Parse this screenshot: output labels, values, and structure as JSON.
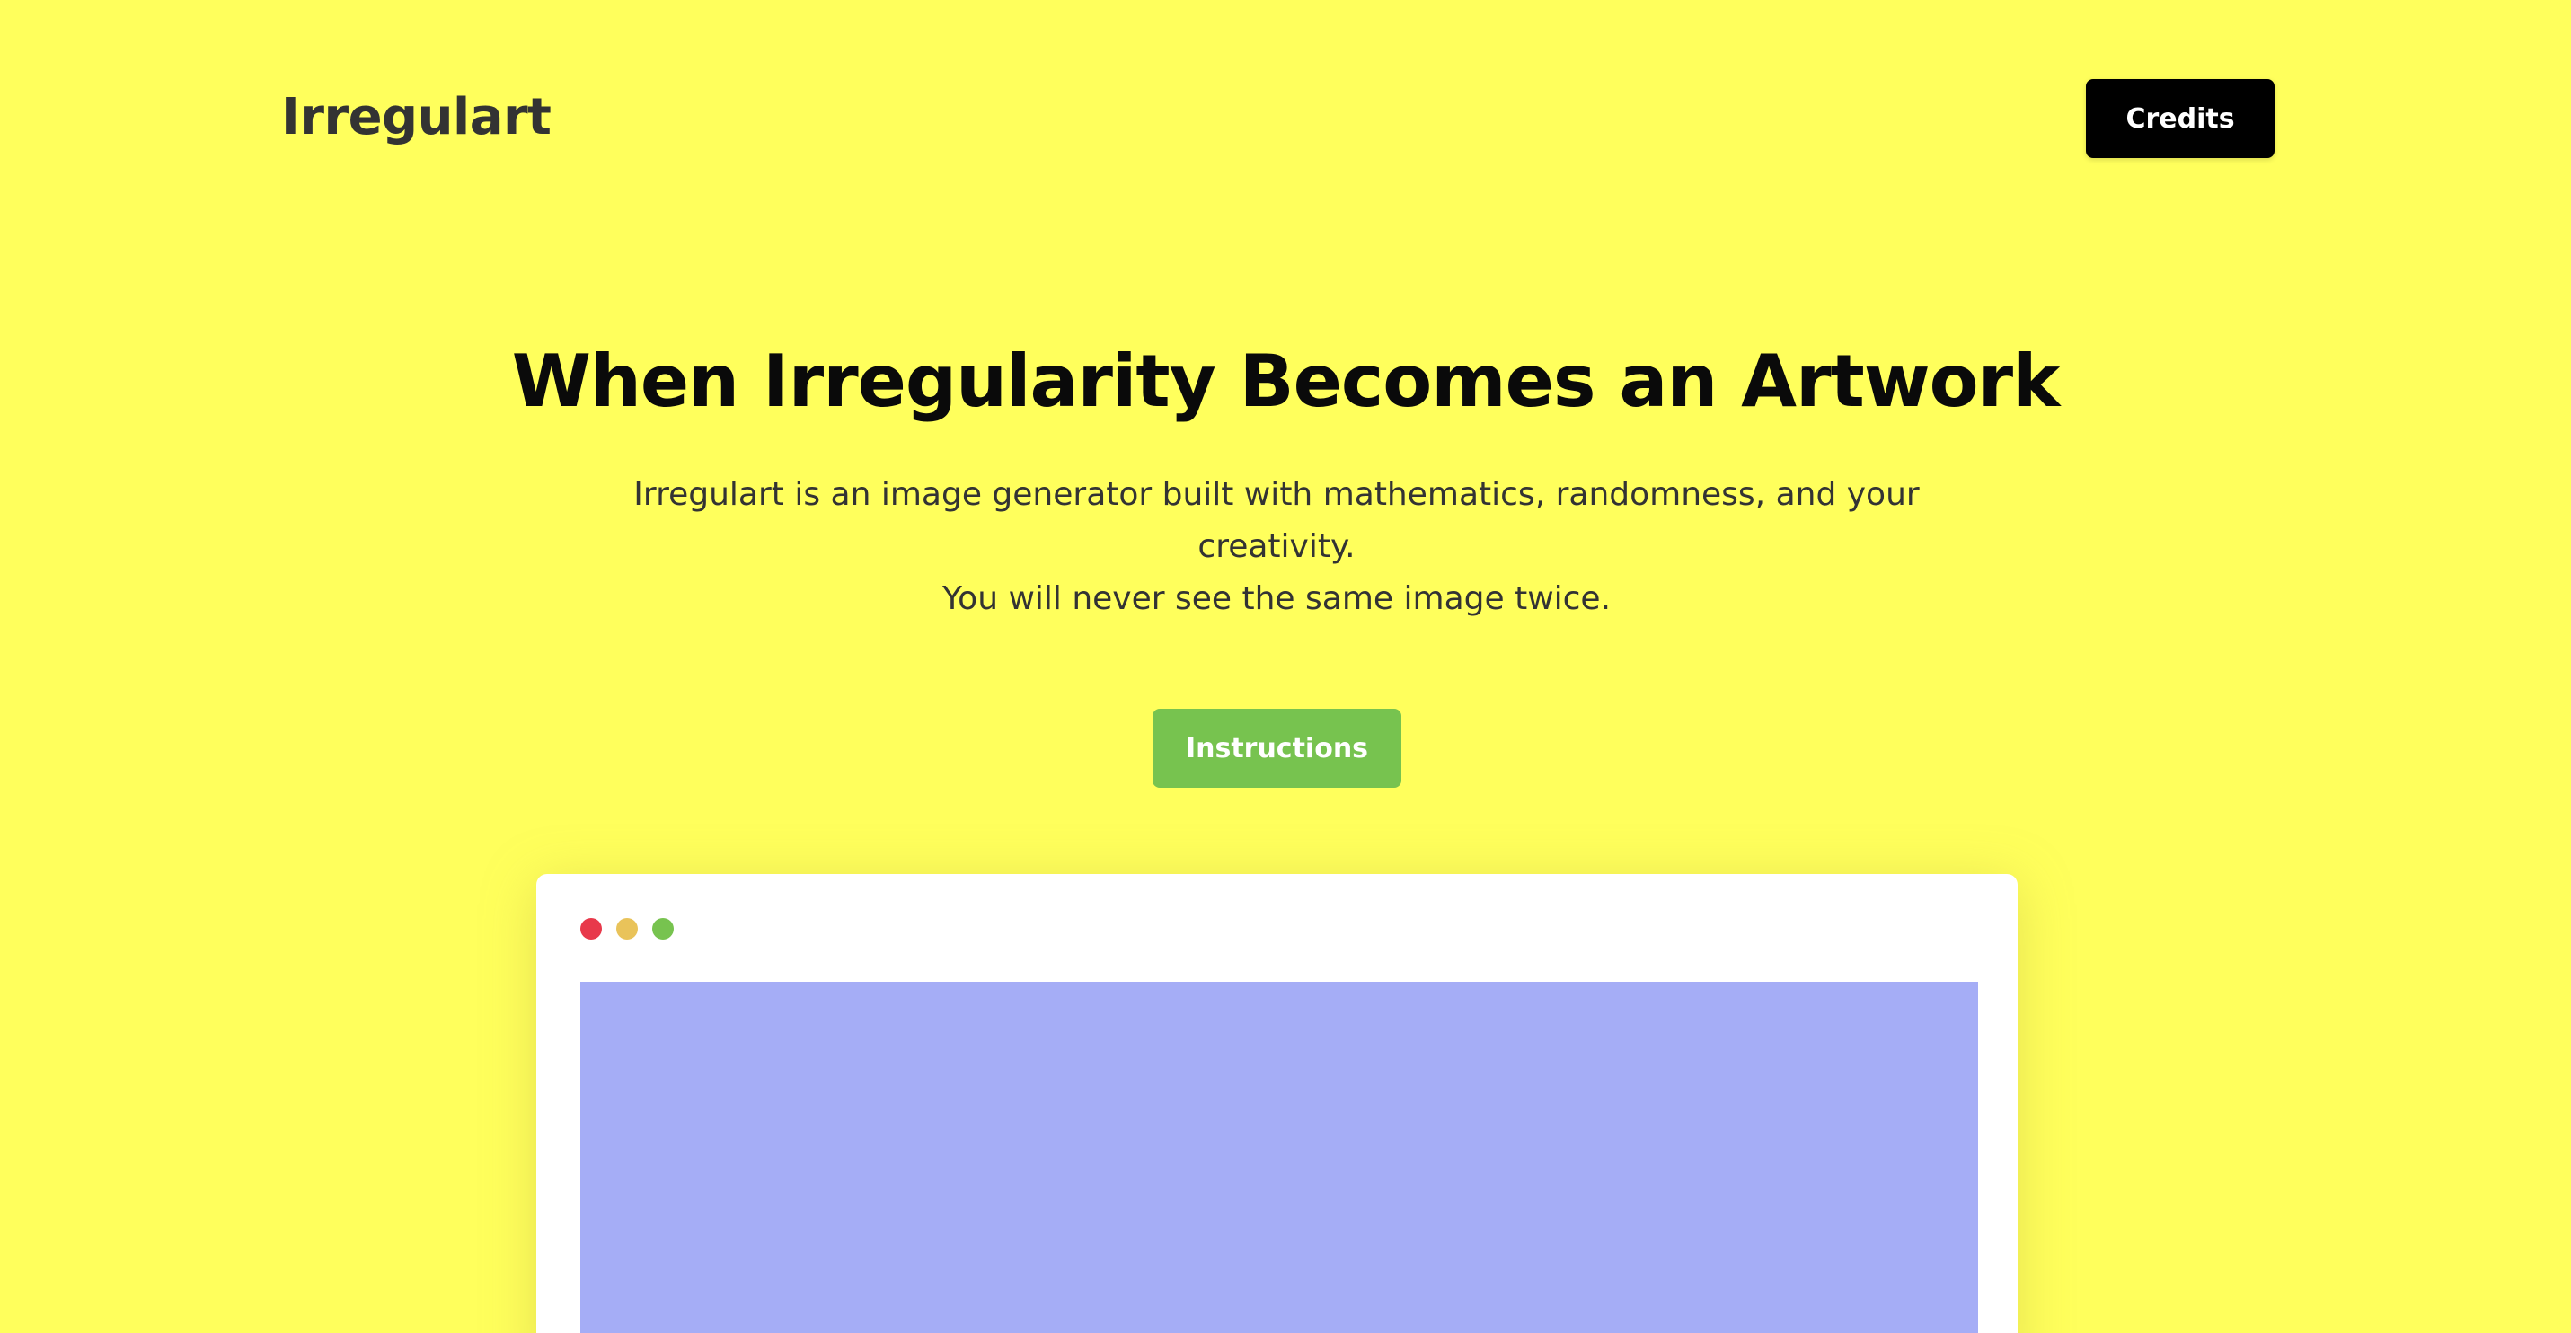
{
  "header": {
    "logo": "Irregulart",
    "credits_label": "Credits"
  },
  "hero": {
    "title": "When Irregularity Becomes an Artwork",
    "description_line1": "Irregulart is an image generator built with mathematics, randomness, and your creativity.",
    "description_line2": "You will never see the same image twice.",
    "instructions_label": "Instructions"
  },
  "preview_window": {
    "controls": [
      "close-dot",
      "minimize-dot",
      "maximize-dot"
    ],
    "canvas_color": "#A5ADF6"
  },
  "colors": {
    "background": "#FFFF5C",
    "primary_button": "#000000",
    "accent_button": "#77C34F",
    "dot_red": "#E8394B",
    "dot_yellow": "#E9C35A",
    "dot_green": "#77C34F"
  }
}
